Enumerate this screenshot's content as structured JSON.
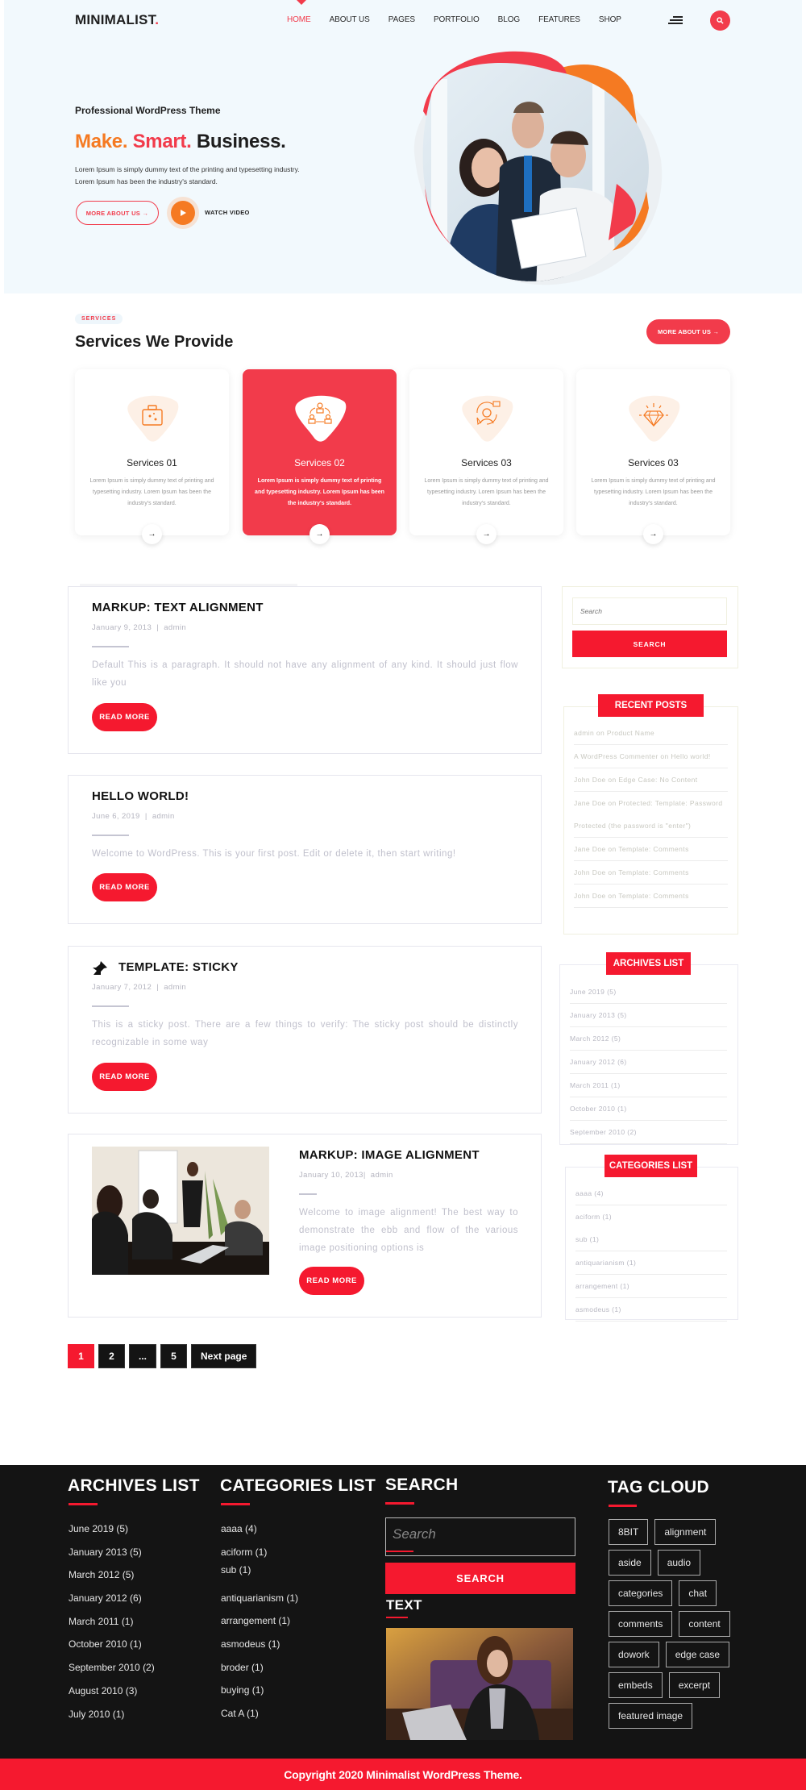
{
  "header": {
    "logo_text": "MINIMALIST",
    "logo_dot": ".",
    "nav": [
      {
        "label": "HOME",
        "active": true
      },
      {
        "label": "ABOUT US"
      },
      {
        "label": "PAGES"
      },
      {
        "label": "PORTFOLIO"
      },
      {
        "label": "BLOG"
      },
      {
        "label": "FEATURES"
      },
      {
        "label": "SHOP"
      }
    ],
    "menu_icon": "hamburger-icon",
    "search_icon": "search-icon"
  },
  "hero": {
    "kicker": "Professional WordPress Theme",
    "title_word1": "Make.",
    "title_word2": "Smart.",
    "title_word3": "Business.",
    "description_line1": "Lorem Ipsum is simply dummy text of the printing and typesetting industry.",
    "description_line2": "Lorem Ipsum has been the industry's standard.",
    "cta_label": "MORE ABOUT US →",
    "video_label": "WATCH VIDEO"
  },
  "services": {
    "kicker": "SERVICES",
    "title": "Services We Provide",
    "cta_label": "MORE ABOUT US →",
    "cards": [
      {
        "title": "Services 01",
        "icon": "suitcase-icon",
        "text": "Lorem Ipsum is simply dummy text of printing and typesetting industry. Lorem Ipsum has been the industry's standard.",
        "arrow": "→"
      },
      {
        "title": "Services 02",
        "icon": "teamwork-cycle-icon",
        "text": "Lorem Ipsum is simply dummy text of printing and typesetting industry. Lorem Ipsum has been the industry's standard.",
        "arrow": "→",
        "active": true
      },
      {
        "title": "Services 03",
        "icon": "support-agent-icon",
        "text": "Lorem Ipsum is simply dummy text of printing and typesetting industry. Lorem Ipsum has been the industry's standard.",
        "arrow": "→"
      },
      {
        "title": "Services 03",
        "icon": "diamond-icon",
        "text": "Lorem Ipsum is simply dummy text of printing and typesetting industry. Lorem Ipsum has been the industry's standard.",
        "arrow": "→"
      }
    ]
  },
  "posts": [
    {
      "title": "MARKUP: TEXT ALIGNMENT",
      "date": "January 9, 2013",
      "sep": "|",
      "author": "admin",
      "excerpt": "Default This is a paragraph. It should not have any alignment of any kind. It should just flow like you",
      "read_more": "READ MORE"
    },
    {
      "title": "HELLO WORLD!",
      "date": "June 6, 2019",
      "sep": "|",
      "author": "admin",
      "excerpt": "Welcome to WordPress. This is your first post. Edit or delete it, then start writing!",
      "read_more": "READ MORE"
    },
    {
      "title": "TEMPLATE: STICKY",
      "date": "January 7, 2012",
      "sep": "|",
      "author": "admin",
      "excerpt": "This is a sticky post. There are a few things to verify: The sticky post should be distinctly recognizable in some way",
      "read_more": "READ MORE",
      "sticky": true
    },
    {
      "title": "MARKUP: IMAGE ALIGNMENT",
      "date": "January 10, 2013",
      "sep": "|",
      "author": "admin",
      "excerpt": "Welcome to image alignment! The best way to demonstrate the ebb and flow of the various image positioning options is",
      "read_more": "READ MORE"
    }
  ],
  "pagination": {
    "pages": [
      "1",
      "2",
      "...",
      "5"
    ],
    "current": "1",
    "next_label": "Next page"
  },
  "sidebar": {
    "search_placeholder": "Search",
    "search_button": "SEARCH",
    "recent_posts_title": "RECENT POSTS",
    "recent_posts": [
      "admin on Product Name",
      "A WordPress Commenter on Hello world!",
      "John Doe on Edge Case: No Content",
      "Jane Doe on Protected: Template: Password Protected (the password is \"enter\")",
      "Jane Doe on Template: Comments",
      "John Doe on Template: Comments",
      "John Doe on Template: Comments"
    ],
    "archives_title": "ARCHIVES LIST",
    "archives": [
      "June 2019 (5)",
      "January 2013 (5)",
      "March 2012 (5)",
      "January 2012 (6)",
      "March 2011 (1)",
      "October 2010 (1)",
      "September 2010 (2)"
    ],
    "categories_title": "CATEGORIES LIST",
    "categories": [
      "aaaa (4)",
      "aciform (1)",
      "sub (1)",
      "antiquarianism (1)",
      "arrangement (1)",
      "asmodeus (1)"
    ]
  },
  "footer": {
    "archives_title": "ARCHIVES LIST",
    "archives": [
      "June 2019 (5)",
      "January 2013 (5)",
      "March 2012 (5)",
      "January 2012 (6)",
      "March 2011 (1)",
      "October 2010 (1)",
      "September 2010 (2)",
      "August 2010 (3)",
      "July 2010 (1)"
    ],
    "categories_title": "CATEGORIES LIST",
    "categories": [
      "aaaa (4)",
      "aciform (1)",
      "sub (1)",
      "antiquarianism (1)",
      "arrangement (1)",
      "asmodeus (1)",
      "broder (1)",
      "buying (1)",
      "Cat A (1)"
    ],
    "search_title": "SEARCH",
    "search_placeholder": "Search",
    "search_button": "SEARCH",
    "text_title": "TEXT",
    "tag_title": "TAG CLOUD",
    "tags": [
      "8BIT",
      "alignment",
      "aside",
      "audio",
      "categories",
      "chat",
      "comments",
      "content",
      "dowork",
      "edge case",
      "embeds",
      "excerpt",
      "featured image"
    ],
    "copyright": "Copyright 2020 Minimalist WordPress Theme."
  },
  "colors": {
    "brand_red": "#f23b4b",
    "accent_red": "#f5192f",
    "accent_orange": "#f57a22",
    "hero_bg": "#f2f9fd",
    "footer_bg": "#141414"
  }
}
